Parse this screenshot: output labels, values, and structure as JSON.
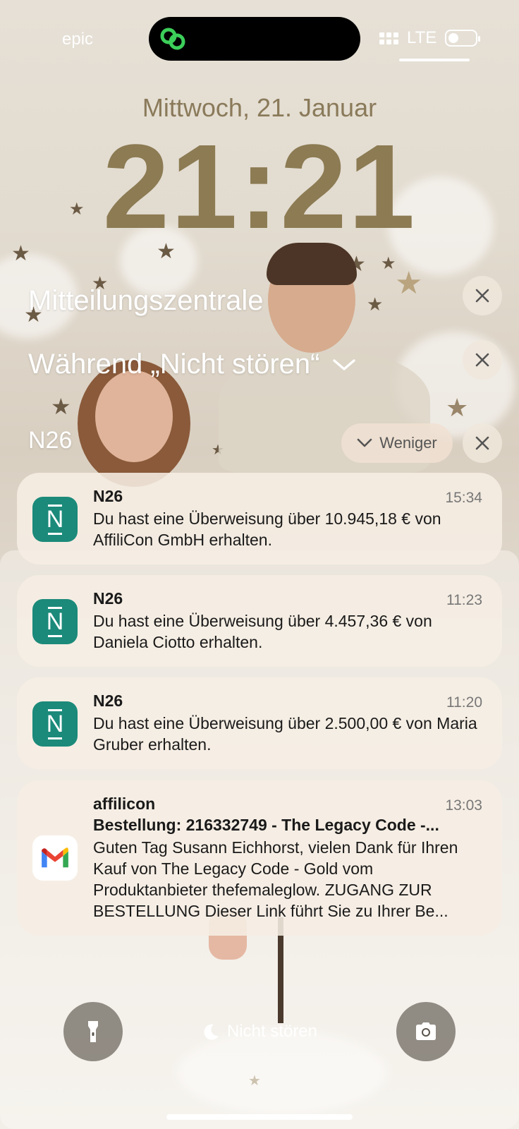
{
  "status_bar": {
    "carrier": "epic",
    "network": "LTE"
  },
  "lock_screen": {
    "date": "Mittwoch, 21. Januar",
    "time": "21:21"
  },
  "notification_center": {
    "title": "Mitteilungszentrale",
    "dnd_section_title": "Während „Nicht stören“",
    "group_title": "N26",
    "less_button": "Weniger"
  },
  "notifications": [
    {
      "app": "N26",
      "time": "15:34",
      "body": "Du hast eine Überweisung über 10.945,18 € von AffiliCon GmbH erhalten.",
      "icon": "n26-icon"
    },
    {
      "app": "N26",
      "time": "11:23",
      "body": "Du hast eine Überweisung über 4.457,36 € von Daniela Ciotto erhalten.",
      "icon": "n26-icon"
    },
    {
      "app": "N26",
      "time": "11:20",
      "body": "Du hast eine Überweisung über 2.500,00 € von Maria Gruber erhalten.",
      "icon": "n26-icon"
    },
    {
      "app": "affilicon",
      "time": "13:03",
      "subject": "Bestellung: 216332749 - The Legacy Code -...",
      "body": "Guten Tag Susann Eichhorst, vielen Dank für Ihren Kauf von The Legacy Code - Gold vom Produktanbieter thefemaleglow. ZUGANG ZUR BESTELLUNG Dieser Link führt Sie zu Ihrer Be...",
      "icon": "gmail-icon"
    }
  ],
  "bottom": {
    "focus_label": "Nicht stören"
  },
  "colors": {
    "n26": "#1b8a7a",
    "clock": "#8c7b53"
  }
}
